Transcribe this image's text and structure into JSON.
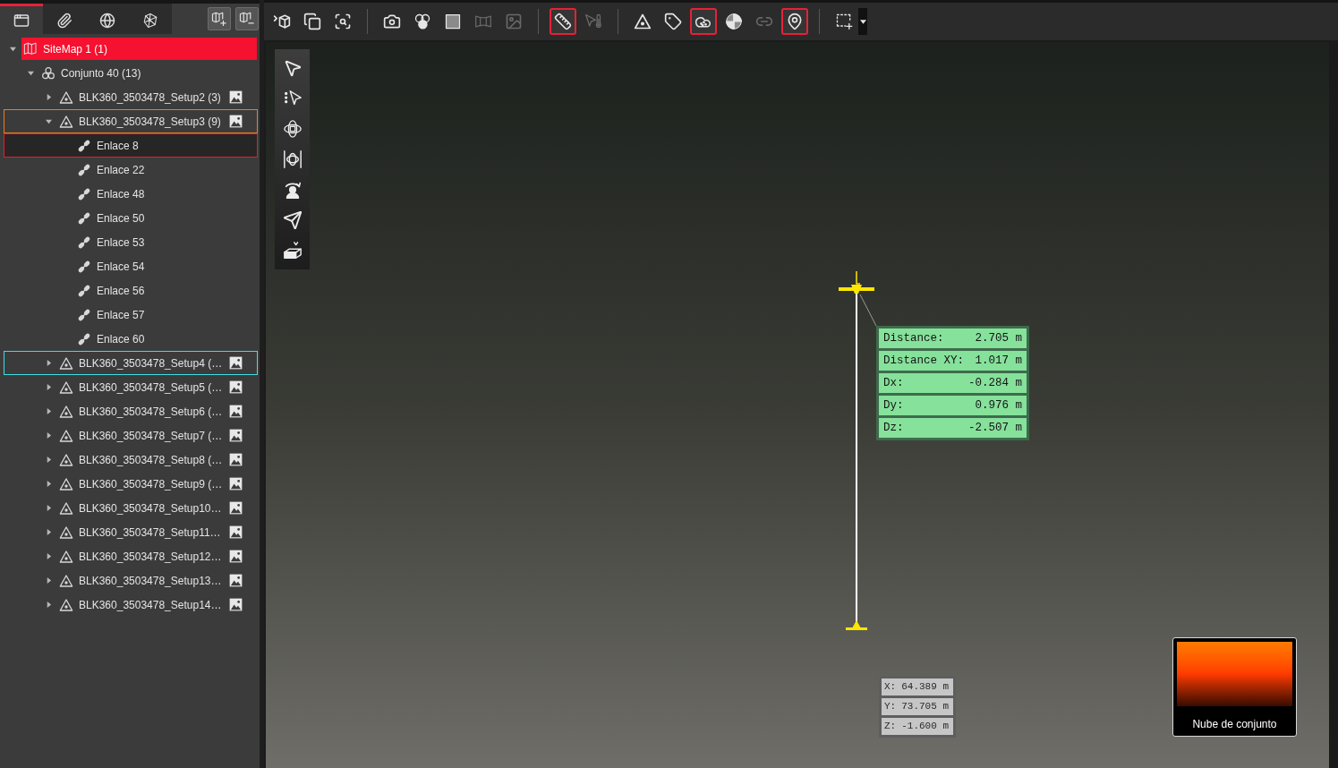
{
  "sidebar": {
    "tabs": [
      {
        "selected": true
      },
      {
        "selected": false
      },
      {
        "selected": false
      },
      {
        "selected": false
      }
    ],
    "tree": [
      {
        "kind": "sitemap",
        "label": "SiteMap 1 (1)",
        "active": true,
        "selected": false,
        "expanded": true,
        "children": [
          {
            "kind": "bundle",
            "label": "Conjunto 40 (13)",
            "selected": false,
            "expanded": true,
            "children": [
              {
                "kind": "setup",
                "label": "BLK360_3503478_Setup2 (3)",
                "selected": false,
                "expanded": false
              },
              {
                "kind": "setup",
                "label": "BLK360_3503478_Setup3 (9)",
                "selected": false,
                "expanded": true,
                "color": "#f07a1e",
                "children": [
                  {
                    "kind": "link",
                    "label": "Enlace 8",
                    "selected": true
                  },
                  {
                    "kind": "link",
                    "label": "Enlace 22",
                    "selected": false
                  },
                  {
                    "kind": "link",
                    "label": "Enlace 48",
                    "selected": false
                  },
                  {
                    "kind": "link",
                    "label": "Enlace 50",
                    "selected": false
                  },
                  {
                    "kind": "link",
                    "label": "Enlace 53",
                    "selected": false
                  },
                  {
                    "kind": "link",
                    "label": "Enlace 54",
                    "selected": false
                  },
                  {
                    "kind": "link",
                    "label": "Enlace 56",
                    "selected": false
                  },
                  {
                    "kind": "link",
                    "label": "Enlace 57",
                    "selected": false
                  },
                  {
                    "kind": "link",
                    "label": "Enlace 60",
                    "selected": false
                  }
                ]
              },
              {
                "kind": "setup",
                "label": "BLK360_3503478_Setup4 (…",
                "selected": false,
                "expanded": false,
                "color": "#3fdde6"
              },
              {
                "kind": "setup",
                "label": "BLK360_3503478_Setup5 (…",
                "selected": false,
                "expanded": false
              },
              {
                "kind": "setup",
                "label": "BLK360_3503478_Setup6 (…",
                "selected": false,
                "expanded": false
              },
              {
                "kind": "setup",
                "label": "BLK360_3503478_Setup7 (…",
                "selected": false,
                "expanded": false
              },
              {
                "kind": "setup",
                "label": "BLK360_3503478_Setup8 (…",
                "selected": false,
                "expanded": false
              },
              {
                "kind": "setup",
                "label": "BLK360_3503478_Setup9 (…",
                "selected": false,
                "expanded": false
              },
              {
                "kind": "setup",
                "label": "BLK360_3503478_Setup10…",
                "selected": false,
                "expanded": false
              },
              {
                "kind": "setup",
                "label": "BLK360_3503478_Setup11…",
                "selected": false,
                "expanded": false
              },
              {
                "kind": "setup",
                "label": "BLK360_3503478_Setup12…",
                "selected": false,
                "expanded": false
              },
              {
                "kind": "setup",
                "label": "BLK360_3503478_Setup13…",
                "selected": false,
                "expanded": false
              },
              {
                "kind": "setup",
                "label": "BLK360_3503478_Setup14…",
                "selected": false,
                "expanded": false
              }
            ]
          }
        ]
      }
    ]
  },
  "toolbar": {
    "groups": [
      [
        {
          "active": false,
          "disabled": false
        },
        {
          "active": false,
          "disabled": false
        },
        {
          "active": false,
          "disabled": false
        }
      ],
      [
        {
          "active": false,
          "disabled": false
        },
        {
          "active": false,
          "disabled": false
        },
        {
          "active": false,
          "disabled": false
        },
        {
          "active": false,
          "disabled": true
        },
        {
          "active": false,
          "disabled": true
        }
      ],
      [
        {
          "active": true,
          "disabled": false
        },
        {
          "active": false,
          "disabled": true
        }
      ],
      [
        {
          "active": false,
          "disabled": false
        },
        {
          "active": false,
          "disabled": false
        },
        {
          "active": true,
          "disabled": false
        },
        {
          "active": false,
          "disabled": false
        },
        {
          "active": false,
          "disabled": true
        },
        {
          "active": true,
          "disabled": false
        }
      ],
      [
        {
          "active": false,
          "disabled": false
        }
      ]
    ]
  },
  "viewport": {
    "measurement": [
      {
        "label": "Distance:",
        "value": "2.705 m"
      },
      {
        "label": "Distance XY:",
        "value": "1.017 m"
      },
      {
        "label": "Dx:",
        "value": "-0.284 m"
      },
      {
        "label": "Dy:",
        "value": "0.976 m"
      },
      {
        "label": "Dz:",
        "value": "-2.507 m"
      }
    ],
    "coordinates": [
      {
        "label": "X:",
        "value": "64.389 m"
      },
      {
        "label": "Y:",
        "value": "73.705 m"
      },
      {
        "label": "Z:",
        "value": "-1.600 m"
      }
    ],
    "thumbnail": {
      "caption": "Nube de conjunto"
    }
  }
}
